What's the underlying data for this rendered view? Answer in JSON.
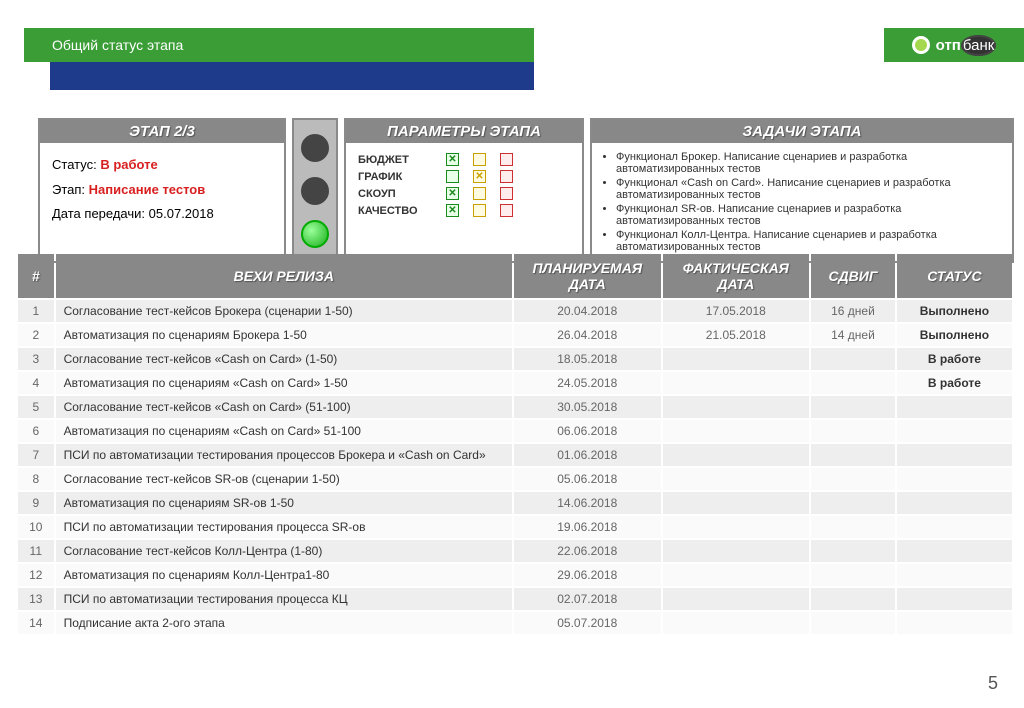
{
  "title": "Общий статус этапа",
  "logo": {
    "brand": "отп",
    "suffix": "банк"
  },
  "stage": {
    "head": "ЭТАП 2/3",
    "status_label": "Статус:",
    "status_value": "В работе",
    "phase_label": "Этап:",
    "phase_value": "Написание тестов",
    "handover_label": "Дата передачи:",
    "handover_value": "05.07.2018"
  },
  "params": {
    "head": "ПАРАМЕТРЫ ЭТАПА",
    "rows": [
      {
        "label": "БЮДЖЕТ",
        "g": "x",
        "y": "",
        "r": ""
      },
      {
        "label": "ГРАФИК",
        "g": "",
        "y": "x",
        "r": ""
      },
      {
        "label": "СКОУП",
        "g": "x",
        "y": "",
        "r": ""
      },
      {
        "label": "КАЧЕСТВО",
        "g": "x",
        "y": "",
        "r": ""
      }
    ]
  },
  "tasks": {
    "head": "ЗАДАЧИ ЭТАПА",
    "items": [
      "Функционал Брокер. Написание сценариев и разработка автоматизированных тестов",
      "Функционал «Cash on Card». Написание сценариев и разработка автоматизированных тестов",
      "Функционал SR-ов. Написание сценариев и разработка автоматизированных тестов",
      "Функционал Колл-Центра. Написание сценариев и разработка автоматизированных тестов"
    ]
  },
  "milestones": {
    "headers": {
      "num": "#",
      "name": "ВЕХИ РЕЛИЗА",
      "plan": "ПЛАНИРУЕМАЯ ДАТА",
      "fact": "ФАКТИЧЕСКАЯ ДАТА",
      "shift": "СДВИГ",
      "status": "СТАТУС"
    },
    "rows": [
      {
        "n": "1",
        "name": "Согласование тест-кейсов Брокера  (сценарии 1-50)",
        "plan": "20.04.2018",
        "fact": "17.05.2018",
        "shift": "16 дней",
        "status": "Выполнено"
      },
      {
        "n": "2",
        "name": "Автоматизация по сценариям Брокера 1-50",
        "plan": "26.04.2018",
        "fact": "21.05.2018",
        "shift": "14 дней",
        "status": "Выполнено"
      },
      {
        "n": "3",
        "name": "Согласование тест-кейсов «Cash on Card» (1-50)",
        "plan": "18.05.2018",
        "fact": "",
        "shift": "",
        "status": "В работе"
      },
      {
        "n": "4",
        "name": "Автоматизация по сценариям «Cash on Card» 1-50",
        "plan": "24.05.2018",
        "fact": "",
        "shift": "",
        "status": "В работе"
      },
      {
        "n": "5",
        "name": "Согласование тест-кейсов «Cash on Card» (51-100)",
        "plan": "30.05.2018",
        "fact": "",
        "shift": "",
        "status": ""
      },
      {
        "n": "6",
        "name": "Автоматизация по сценариям «Cash on Card» 51-100",
        "plan": "06.06.2018",
        "fact": "",
        "shift": "",
        "status": ""
      },
      {
        "n": "7",
        "name": "ПСИ по автоматизации тестирования процессов Брокера и «Cash on Card»",
        "plan": "01.06.2018",
        "fact": "",
        "shift": "",
        "status": ""
      },
      {
        "n": "8",
        "name": "Согласование тест-кейсов SR-ов (сценарии 1-50)",
        "plan": "05.06.2018",
        "fact": "",
        "shift": "",
        "status": ""
      },
      {
        "n": "9",
        "name": "Автоматизация по сценариям SR-ов 1-50",
        "plan": "14.06.2018",
        "fact": "",
        "shift": "",
        "status": ""
      },
      {
        "n": "10",
        "name": "ПСИ по автоматизации тестирования процесса SR-ов",
        "plan": "19.06.2018",
        "fact": "",
        "shift": "",
        "status": ""
      },
      {
        "n": "11",
        "name": "Согласование тест-кейсов Колл-Центра (1-80)",
        "plan": "22.06.2018",
        "fact": "",
        "shift": "",
        "status": ""
      },
      {
        "n": "12",
        "name": "Автоматизация по сценариям Колл-Центра1-80",
        "plan": "29.06.2018",
        "fact": "",
        "shift": "",
        "status": ""
      },
      {
        "n": "13",
        "name": "ПСИ по автоматизации тестирования процесса КЦ",
        "plan": "02.07.2018",
        "fact": "",
        "shift": "",
        "status": ""
      },
      {
        "n": "14",
        "name": "Подписание акта 2-ого этапа",
        "plan": "05.07.2018",
        "fact": "",
        "shift": "",
        "status": ""
      }
    ]
  },
  "page_number": "5"
}
